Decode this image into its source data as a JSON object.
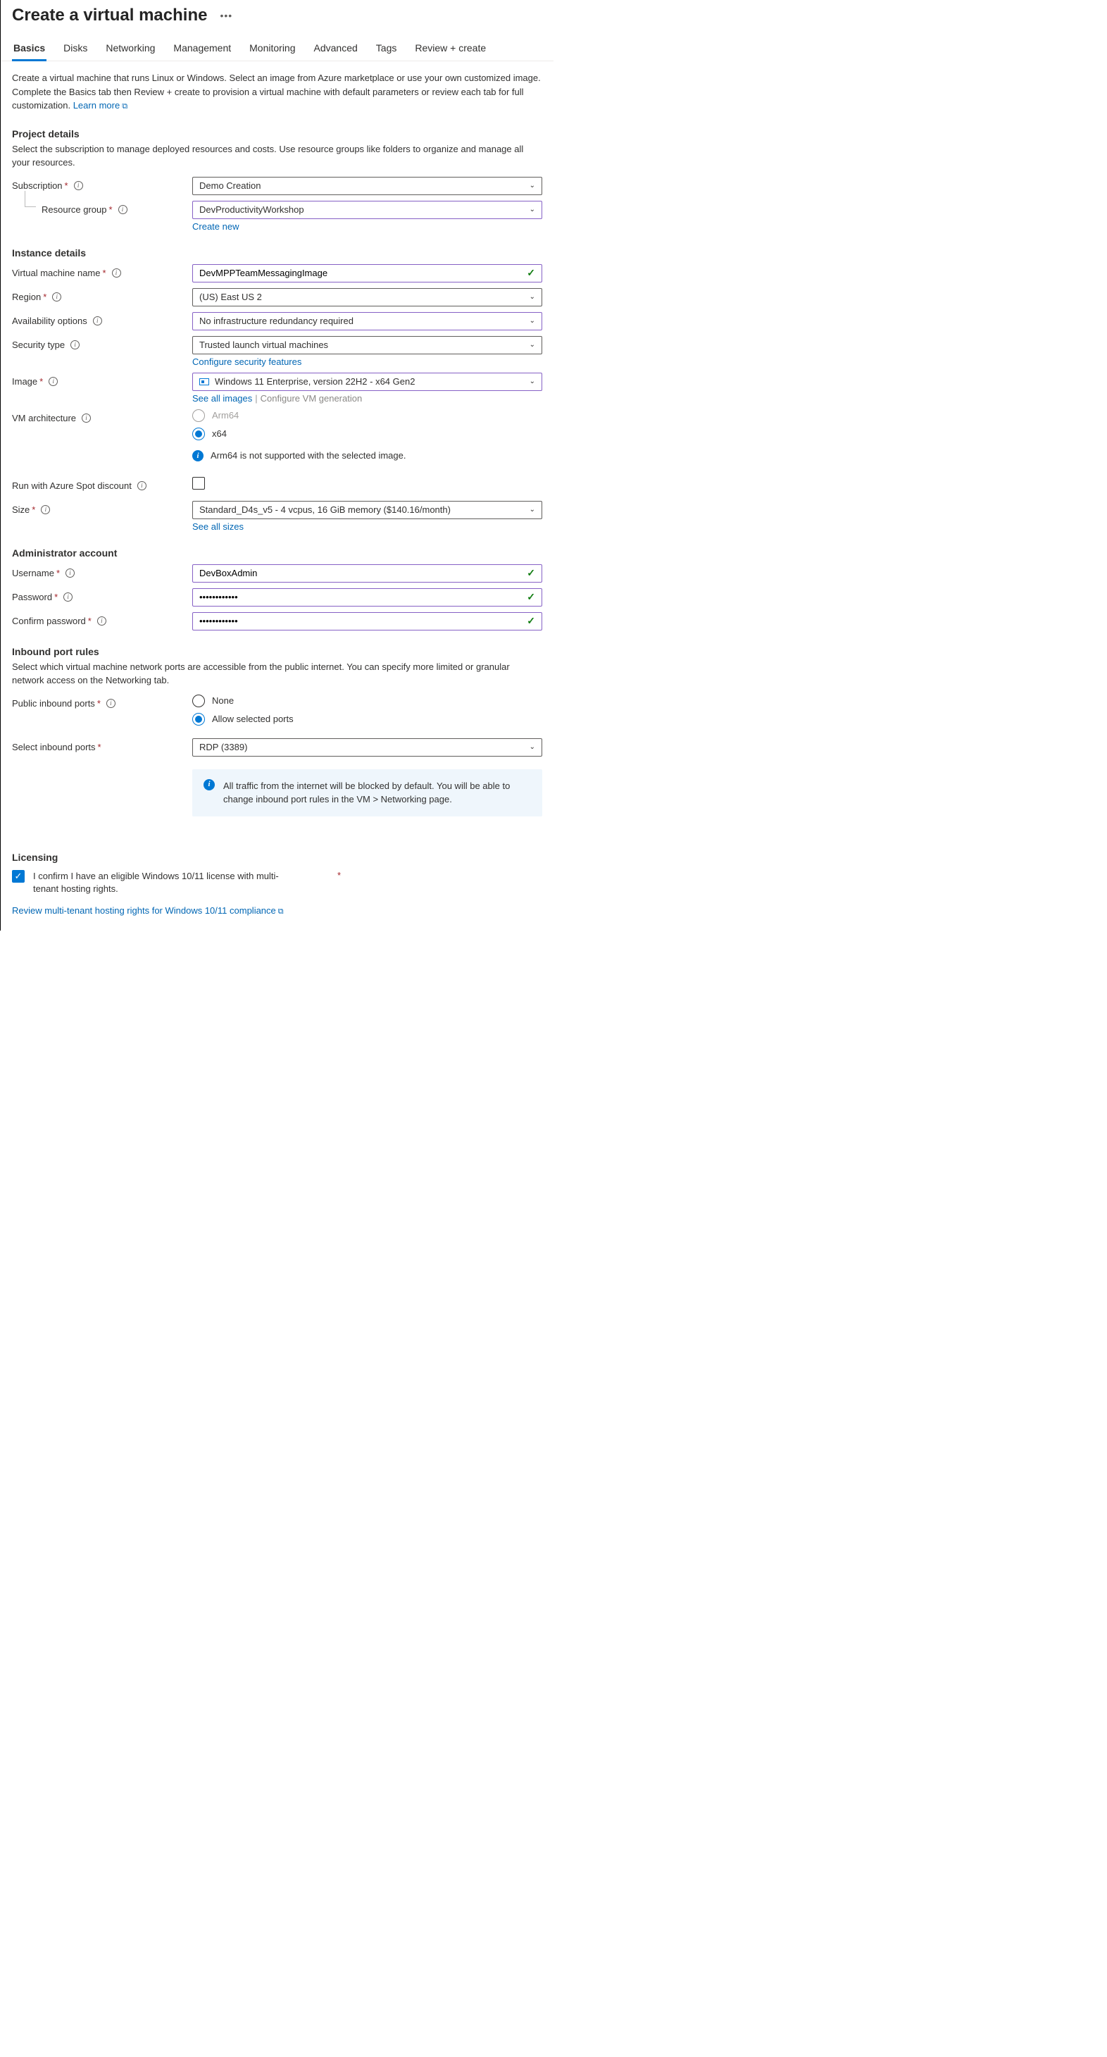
{
  "title": "Create a virtual machine",
  "tabs": [
    "Basics",
    "Disks",
    "Networking",
    "Management",
    "Monitoring",
    "Advanced",
    "Tags",
    "Review + create"
  ],
  "intro_text": "Create a virtual machine that runs Linux or Windows. Select an image from Azure marketplace or use your own customized image. Complete the Basics tab then Review + create to provision a virtual machine with default parameters or review each tab for full customization. ",
  "intro_link": "Learn more",
  "project_details": {
    "title": "Project details",
    "desc": "Select the subscription to manage deployed resources and costs. Use resource groups like folders to organize and manage all your resources.",
    "subscription_label": "Subscription",
    "subscription_value": "Demo Creation",
    "resource_group_label": "Resource group",
    "resource_group_value": "DevProductivityWorkshop",
    "create_new": "Create new"
  },
  "instance_details": {
    "title": "Instance details",
    "vm_name_label": "Virtual machine name",
    "vm_name_value": "DevMPPTeamMessagingImage",
    "region_label": "Region",
    "region_value": "(US) East US 2",
    "availability_label": "Availability options",
    "availability_value": "No infrastructure redundancy required",
    "security_label": "Security type",
    "security_value": "Trusted launch virtual machines",
    "configure_security": "Configure security features",
    "image_label": "Image",
    "image_value": "Windows 11 Enterprise, version 22H2 - x64 Gen2",
    "see_all_images": "See all images",
    "configure_vm_gen": "Configure VM generation",
    "arch_label": "VM architecture",
    "arch_options": {
      "arm64": "Arm64",
      "x64": "x64"
    },
    "arch_info": "Arm64 is not supported with the selected image.",
    "spot_label": "Run with Azure Spot discount",
    "size_label": "Size",
    "size_value": "Standard_D4s_v5 - 4 vcpus, 16 GiB memory ($140.16/month)",
    "see_all_sizes": "See all sizes"
  },
  "admin_account": {
    "title": "Administrator account",
    "username_label": "Username",
    "username_value": "DevBoxAdmin",
    "password_label": "Password",
    "password_value": "••••••••••••",
    "confirm_label": "Confirm password",
    "confirm_value": "••••••••••••"
  },
  "inbound": {
    "title": "Inbound port rules",
    "desc": "Select which virtual machine network ports are accessible from the public internet. You can specify more limited or granular network access on the Networking tab.",
    "public_label": "Public inbound ports",
    "none": "None",
    "allow": "Allow selected ports",
    "select_label": "Select inbound ports",
    "select_value": "RDP (3389)",
    "callout": "All traffic from the internet will be blocked by default. You will be able to change inbound port rules in the VM > Networking page."
  },
  "licensing": {
    "title": "Licensing",
    "check_text": "I confirm I have an eligible Windows 10/11 license with multi-tenant hosting rights.",
    "review_link": "Review multi-tenant hosting rights for Windows 10/11 compliance"
  }
}
